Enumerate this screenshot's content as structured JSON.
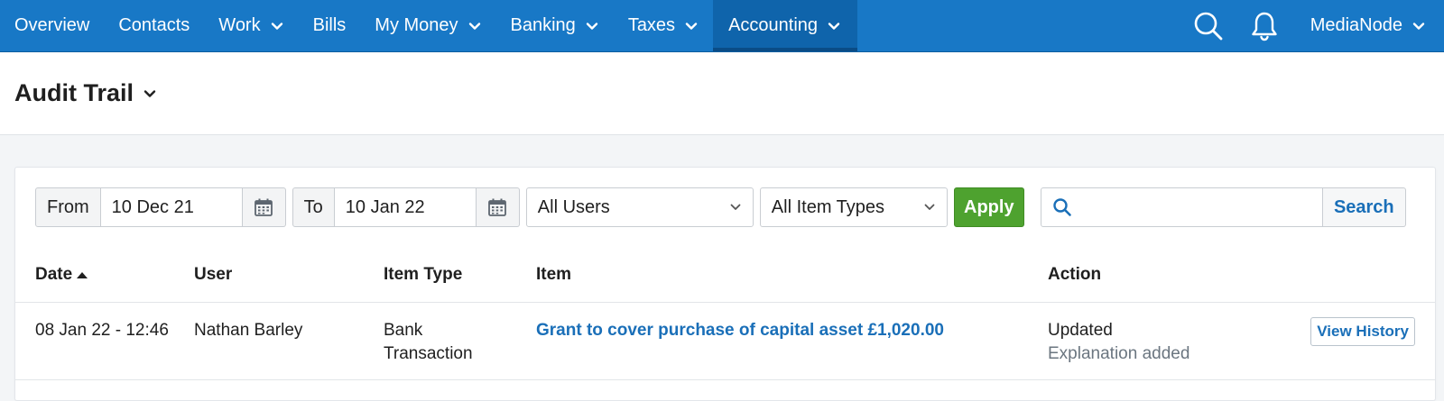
{
  "nav": {
    "items": [
      {
        "label": "Overview",
        "dropdown": false
      },
      {
        "label": "Contacts",
        "dropdown": false
      },
      {
        "label": "Work",
        "dropdown": true
      },
      {
        "label": "Bills",
        "dropdown": false
      },
      {
        "label": "My Money",
        "dropdown": true
      },
      {
        "label": "Banking",
        "dropdown": true
      },
      {
        "label": "Taxes",
        "dropdown": true
      },
      {
        "label": "Accounting",
        "dropdown": true,
        "active": true
      }
    ],
    "user": "MediaNode",
    "icons": [
      "search-icon",
      "bell-icon"
    ]
  },
  "page": {
    "title": "Audit Trail"
  },
  "filters": {
    "from_label": "From",
    "from_value": "10 Dec 21",
    "to_label": "To",
    "to_value": "10 Jan 22",
    "users_select": "All Users",
    "item_types_select": "All Item Types",
    "apply_label": "Apply",
    "search_placeholder": "",
    "search_label": "Search"
  },
  "table": {
    "columns": [
      "Date",
      "User",
      "Item Type",
      "Item",
      "Action"
    ],
    "sort": {
      "column": "Date",
      "direction": "ascending"
    },
    "rows": [
      {
        "date": "08 Jan 22 - 12:46",
        "user": "Nathan Barley",
        "item_type_line1": "Bank",
        "item_type_line2": "Transaction",
        "item": "Grant to cover purchase of capital asset £1,020.00",
        "action": "Updated",
        "action_detail": "Explanation added",
        "button": "View History"
      }
    ]
  },
  "colors": {
    "nav_bg": "#1878c6",
    "nav_active": "#0f64ab",
    "link": "#1a6fb8",
    "apply_green": "#4ea22f",
    "muted_text": "#6b7680"
  }
}
